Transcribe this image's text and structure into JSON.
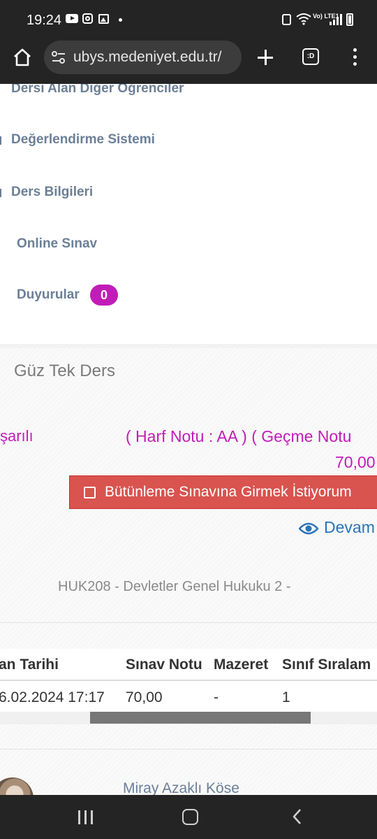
{
  "status_bar": {
    "time": "19:24",
    "network": "Vo) LTE1"
  },
  "browser": {
    "url": "ubys.medeniyet.edu.tr/",
    "tab_count": ":D"
  },
  "sidebar": {
    "items": [
      {
        "label": "Dersi Alan Diğer Öğrenciler"
      },
      {
        "label": "Değerlendirme Sistemi"
      },
      {
        "label": "Ders Bilgileri"
      },
      {
        "label": "Online Sınav"
      },
      {
        "label": "Duyurular",
        "badge": "0"
      }
    ]
  },
  "course_panel": {
    "title": "Güz Tek Ders",
    "status_text": "şarılı",
    "grade_text": "( Harf Notu : AA ) ( Geçme Notu",
    "grade_value": "70,00",
    "makeup_button": "Bütünleme Sınavına Girmek İstiyorum",
    "attendance_link": "Devam",
    "course_title": "HUK208 - Devletler Genel Hukuku 2 -"
  },
  "exam_table": {
    "headers": [
      "an Tarihi",
      "Sınav Notu",
      "Mazeret",
      "Sınıf Sıralam"
    ],
    "rows": [
      [
        "6.02.2024 17:17",
        "70,00",
        "-",
        "1"
      ]
    ]
  },
  "instructor": {
    "name": "Miray Azaklı Köse"
  },
  "colors": {
    "accent": "#c21cb8",
    "danger": "#d9534f",
    "link": "#2a74b8",
    "nav_text": "#6b7f97"
  }
}
